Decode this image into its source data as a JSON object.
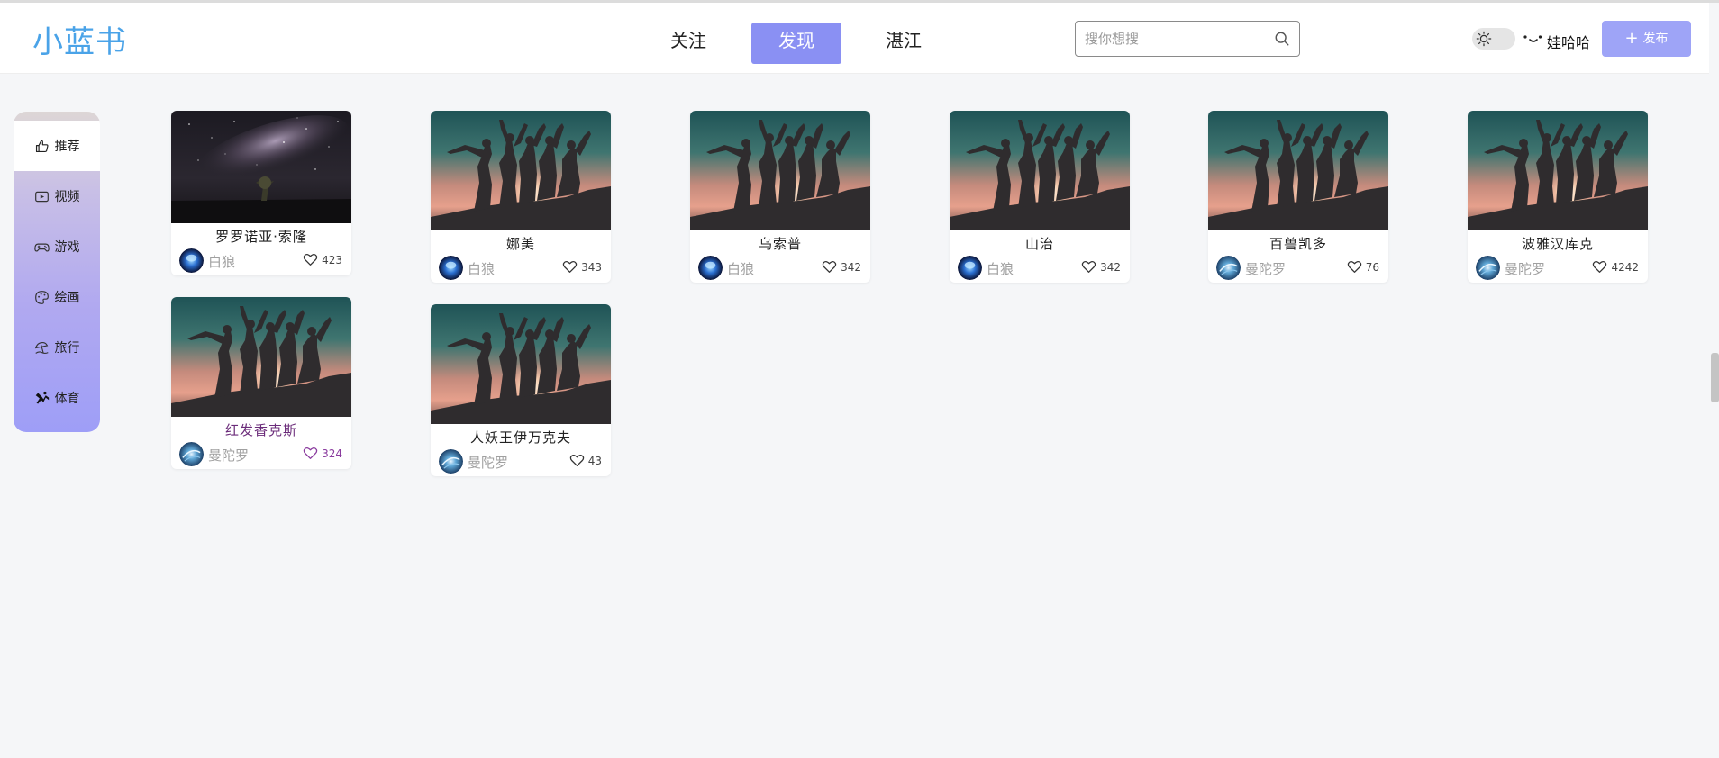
{
  "header": {
    "logo": "小蓝书",
    "tabs": [
      {
        "label": "关注"
      },
      {
        "label": "发现",
        "active": true
      },
      {
        "label": "湛江"
      }
    ],
    "search_placeholder": "搜你想搜",
    "username": "娃哈哈",
    "publish_label": "发布",
    "accent": "#8a90f3"
  },
  "sidebar": {
    "items": [
      {
        "label": "推荐",
        "icon": "thumbs-up-icon",
        "active": true
      },
      {
        "label": "视频",
        "icon": "video-icon"
      },
      {
        "label": "游戏",
        "icon": "gamepad-icon"
      },
      {
        "label": "绘画",
        "icon": "palette-icon"
      },
      {
        "label": "旅行",
        "icon": "umbrella-beach-icon"
      },
      {
        "label": "体育",
        "icon": "sport-icon"
      }
    ]
  },
  "cards": [
    {
      "title": "罗罗诺亚·索隆",
      "author": "白狼",
      "likes": "423",
      "image": "night-sky-image",
      "avatar": "jellyfish-avatar"
    },
    {
      "title": "娜美",
      "author": "白狼",
      "likes": "343",
      "image": "silhouette-image",
      "avatar": "jellyfish-avatar"
    },
    {
      "title": "乌索普",
      "author": "白狼",
      "likes": "342",
      "image": "silhouette-image",
      "avatar": "jellyfish-avatar"
    },
    {
      "title": "山治",
      "author": "白狼",
      "likes": "342",
      "image": "silhouette-image",
      "avatar": "jellyfish-avatar"
    },
    {
      "title": "百兽凯多",
      "author": "曼陀罗",
      "likes": "76",
      "image": "silhouette-image",
      "avatar": "blue-swirl-avatar"
    },
    {
      "title": "波雅汉库克",
      "author": "曼陀罗",
      "likes": "4242",
      "image": "silhouette-image",
      "avatar": "blue-swirl-avatar"
    },
    {
      "title": "红发香克斯",
      "author": "曼陀罗",
      "likes": "324",
      "image": "silhouette-image",
      "avatar": "blue-swirl-avatar",
      "highlight": "#6b2c7a"
    },
    {
      "title": "人妖王伊万克夫",
      "author": "曼陀罗",
      "likes": "43",
      "image": "silhouette-image",
      "avatar": "blue-swirl-avatar"
    }
  ]
}
